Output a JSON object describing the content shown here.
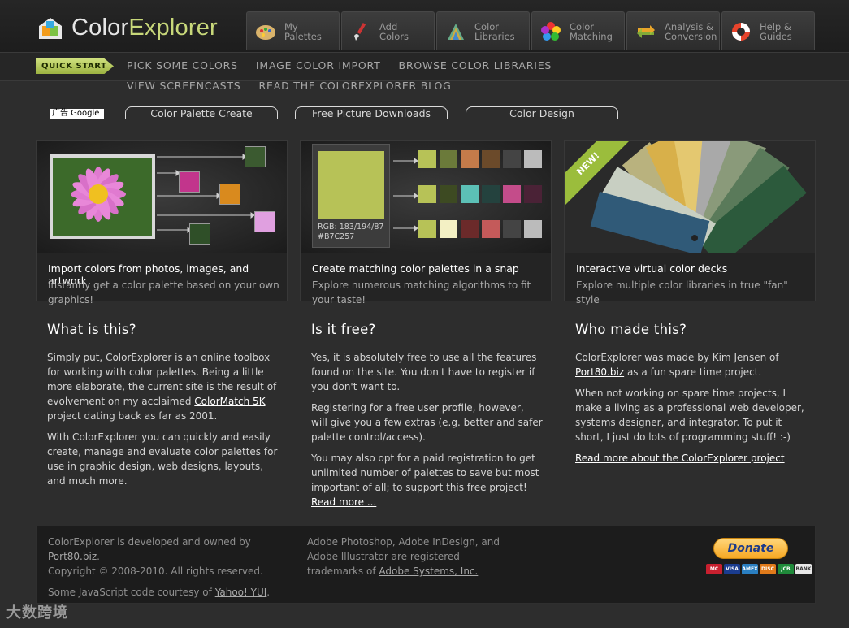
{
  "header": {
    "logo_main": "Color",
    "logo_accent": "Explorer",
    "tabs": [
      {
        "label": "My\nPalettes",
        "icon": "palette-icon"
      },
      {
        "label": "Add\nColors",
        "icon": "brush-icon"
      },
      {
        "label": "Color\nLibraries",
        "icon": "color-fan-icon"
      },
      {
        "label": "Color\nMatching",
        "icon": "color-wheel-icon"
      },
      {
        "label": "Analysis &\nConversion",
        "icon": "convert-arrows-icon"
      },
      {
        "label": "Help &\nGuides",
        "icon": "lifebuoy-icon"
      }
    ]
  },
  "subnav": {
    "quickstart": "QUICK START",
    "links": [
      "PICK SOME COLORS",
      "IMAGE COLOR IMPORT",
      "BROWSE COLOR LIBRARIES",
      "VIEW SCREENCASTS",
      "READ THE COLOREXPLORER BLOG"
    ]
  },
  "ads": {
    "google_label": "广告 Google",
    "pills": [
      "Color Palette Create",
      "Free Picture Downloads",
      "Color Design"
    ]
  },
  "features": [
    {
      "title": "Import colors from photos, images, and artwork",
      "desc": "Instantly get a color palette based on your own graphics!"
    },
    {
      "title": "Create matching color palettes in a snap",
      "desc": "Explore numerous matching algorithms to fit your taste!",
      "rgb_label": "RGB: 183/194/87",
      "hex_label": "#B7C257"
    },
    {
      "title": "Interactive virtual color decks",
      "desc": "Explore multiple color libraries in true \"fan\" style",
      "badge": "NEW!"
    }
  ],
  "columns": {
    "what": {
      "heading": "What is this?",
      "p1_a": "Simply put, ColorExplorer is an online toolbox for working with color palettes. Being a little more elaborate, the current site is the result of evolvement on my acclaimed ",
      "p1_link": "ColorMatch 5K",
      "p1_b": " project dating back as far as 2001.",
      "p2": "With ColorExplorer you can quickly and easily create, manage and evaluate color palettes for use in graphic design, web designs, layouts, and much more."
    },
    "free": {
      "heading": "Is it free?",
      "p1": "Yes, it is absolutely free to use all the features found on the site. You don't have to register if you don't want to.",
      "p2": "Registering for a free user profile, however, will give you a few extras (e.g. better and safer palette control/access).",
      "p3_a": "You may also opt for a paid registration to get unlimited number of palettes to save but most important of all; to support this free project! ",
      "p3_link": "Read more ..."
    },
    "who": {
      "heading": "Who made this?",
      "p1_a": "ColorExplorer was made by Kim Jensen of ",
      "p1_link": "Port80.biz",
      "p1_b": " as a fun spare time project.",
      "p2": "When not working on spare time projects, I make a living as a professional web developer, systems designer, and integrator. To put it short, I just do lots of programming stuff! :-)",
      "p3_link": "Read more about the ColorExplorer project"
    }
  },
  "footer": {
    "c1_a": "ColorExplorer is developed and owned by ",
    "c1_link": "Port80.biz",
    "c1_b": ".",
    "c1_copy": "Copyright © 2008-2010. All rights reserved.",
    "c1_js_a": "Some JavaScript code courtesy of ",
    "c1_js_link": "Yahoo! YUI",
    "c1_js_b": ".",
    "c2_a": "Adobe Photoshop, Adobe InDesign, and Adobe Illustrator are registered trademarks of ",
    "c2_link": "Adobe Systems, Inc.",
    "donate": "Donate",
    "cards": [
      "MC",
      "VISA",
      "AMEX",
      "DISC",
      "JCB",
      "BANK"
    ]
  },
  "watermark": "大数跨境",
  "colors": {
    "accent": "#c8d87a",
    "background": "#2d2d2d"
  }
}
